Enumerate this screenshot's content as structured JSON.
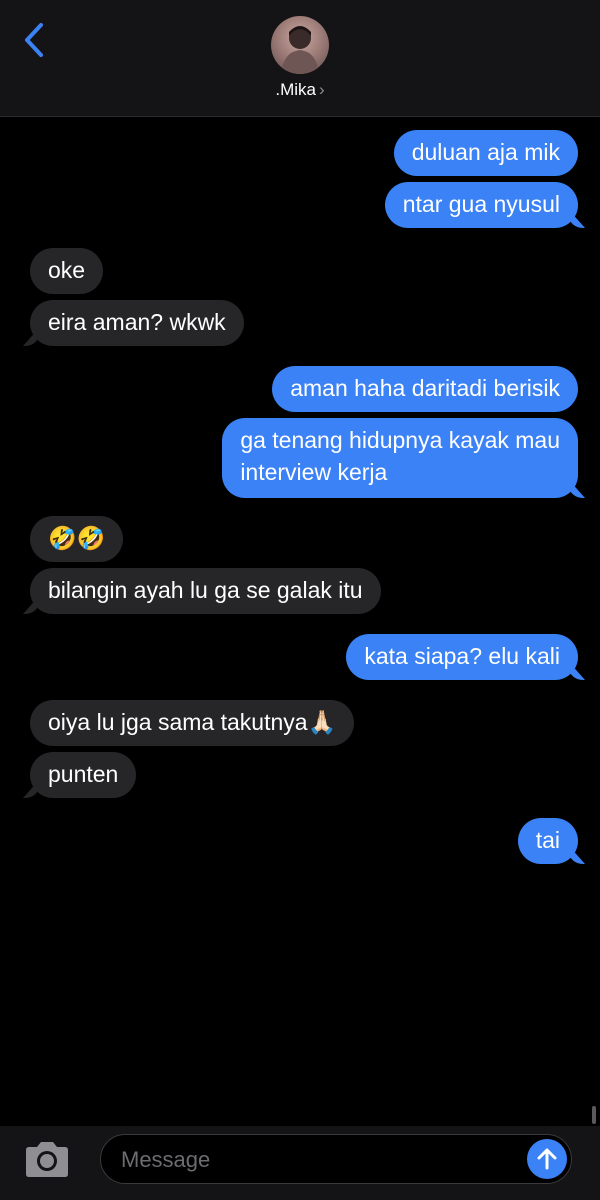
{
  "header": {
    "contact_name": ".Mika",
    "contact_chevron": "›",
    "back_icon": "chevron-left-icon"
  },
  "messages": [
    {
      "side": "out",
      "text": "duluan aja mik"
    },
    {
      "side": "out",
      "text": "ntar gua nyusul"
    },
    {
      "side": "in",
      "text": "oke"
    },
    {
      "side": "in",
      "text": "eira aman? wkwk"
    },
    {
      "side": "out",
      "text": "aman haha daritadi berisik"
    },
    {
      "side": "out",
      "text": "ga tenang hidupnya kayak mau\ninterview kerja"
    },
    {
      "side": "in",
      "text": "🤣🤣"
    },
    {
      "side": "in",
      "text": "bilangin ayah lu ga se galak itu"
    },
    {
      "side": "out",
      "text": "kata siapa? elu kali"
    },
    {
      "side": "in",
      "text": "oiya lu jga sama takutnya🙏🏻"
    },
    {
      "side": "in",
      "text": "punten"
    },
    {
      "side": "out",
      "text": "tai"
    }
  ],
  "composer": {
    "placeholder": "Message",
    "camera_icon": "camera-icon",
    "send_icon": "arrow-up-icon"
  },
  "colors": {
    "outgoing_bubble": "#3b82f6",
    "incoming_bubble": "#262629",
    "background": "#000000",
    "bar": "#141416"
  }
}
